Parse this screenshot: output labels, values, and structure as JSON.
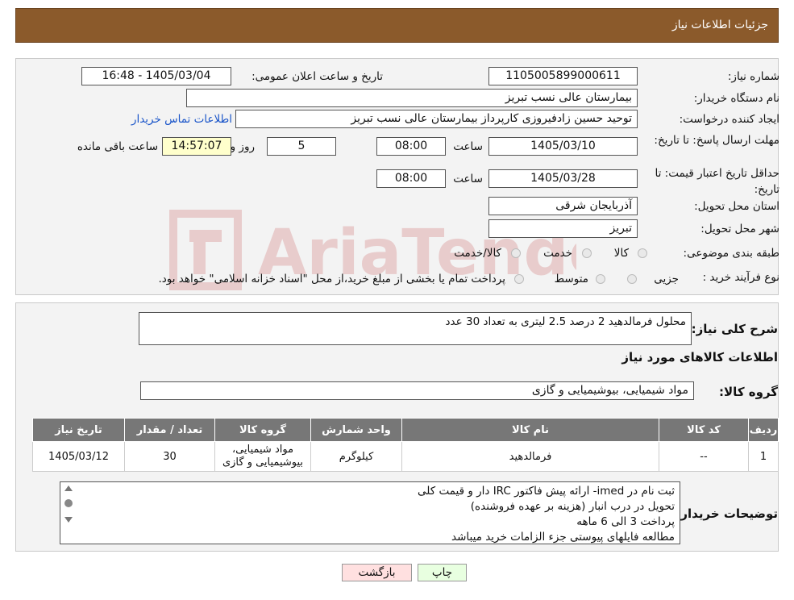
{
  "header": {
    "title": "جزئیات اطلاعات نیاز"
  },
  "form": {
    "need_number_label": "شماره نیاز:",
    "need_number": "1105005899000611",
    "announce_label": "تاریخ و ساعت اعلان عمومی:",
    "announce_value": "1405/03/04 - 16:48",
    "buyer_label": "نام دستگاه خریدار:",
    "buyer_value": "بیمارستان عالی نسب تبریز",
    "creator_label": "ایجاد کننده درخواست:",
    "creator_value": "توحید حسین زادفیروزی کارپرداز بیمارستان عالی نسب تبریز",
    "contact_link": "اطلاعات تماس خریدار",
    "deadline_label": "مهلت ارسال پاسخ: تا تاریخ:",
    "deadline_date": "1405/03/10",
    "time_label": "ساعت",
    "deadline_time": "08:00",
    "days_value": "5",
    "days_label": "روز و",
    "remaining_time": "14:57:07",
    "remaining_label": "ساعت باقی مانده",
    "validity_label": "حداقل تاریخ اعتبار قیمت: تا تاریخ:",
    "validity_date": "1405/03/28",
    "validity_time": "08:00",
    "province_label": "استان محل تحویل:",
    "province_value": "آذربایجان شرقی",
    "city_label": "شهر محل تحویل:",
    "city_value": "تبریز",
    "category_label": "طبقه بندی موضوعی:",
    "category_options": [
      "کالا",
      "خدمت",
      "کالا/خدمت"
    ],
    "process_label": "نوع فرآیند خرید :",
    "process_options": [
      "جزیی",
      "متوسط"
    ],
    "process_note": "پرداخت تمام یا بخشی از مبلغ خرید،از محل \"اسناد خزانه اسلامی\" خواهد بود."
  },
  "details": {
    "summary_label": "شرح کلی نیاز:",
    "summary_value": "محلول فرمالدهید 2 درصد 2.5 لیتری به تعداد 30 عدد",
    "items_title": "اطلاعات کالاهای مورد نیاز",
    "group_label": "گروه کالا:",
    "group_value": "مواد شیمیایی، بیوشیمیایی و  گازی",
    "table": {
      "headers": [
        "ردیف",
        "کد کالا",
        "نام کالا",
        "واحد شمارش",
        "گروه کالا",
        "تعداد / مقدار",
        "تاریخ نیاز"
      ],
      "rows": [
        [
          "1",
          "--",
          "فرمالدهید",
          "کیلوگرم",
          "مواد شیمیایی، بیوشیمیایی و گازی",
          "30",
          "1405/03/12"
        ]
      ]
    },
    "notes_label": "توضیحات خریدار:",
    "notes_lines": [
      "ثبت نام در imed- ارائه پیش فاکتور IRC دار و قیمت کلی",
      "تحویل در درب انبار (هزینه بر عهده فروشنده)",
      "پرداخت  3 الی 6 ماهه",
      "مطالعه فایلهای پیوستی جزء الزامات خرید میباشد"
    ]
  },
  "buttons": {
    "print": "چاپ",
    "back": "بازگشت"
  },
  "watermark_text": "AriaTender.neT"
}
